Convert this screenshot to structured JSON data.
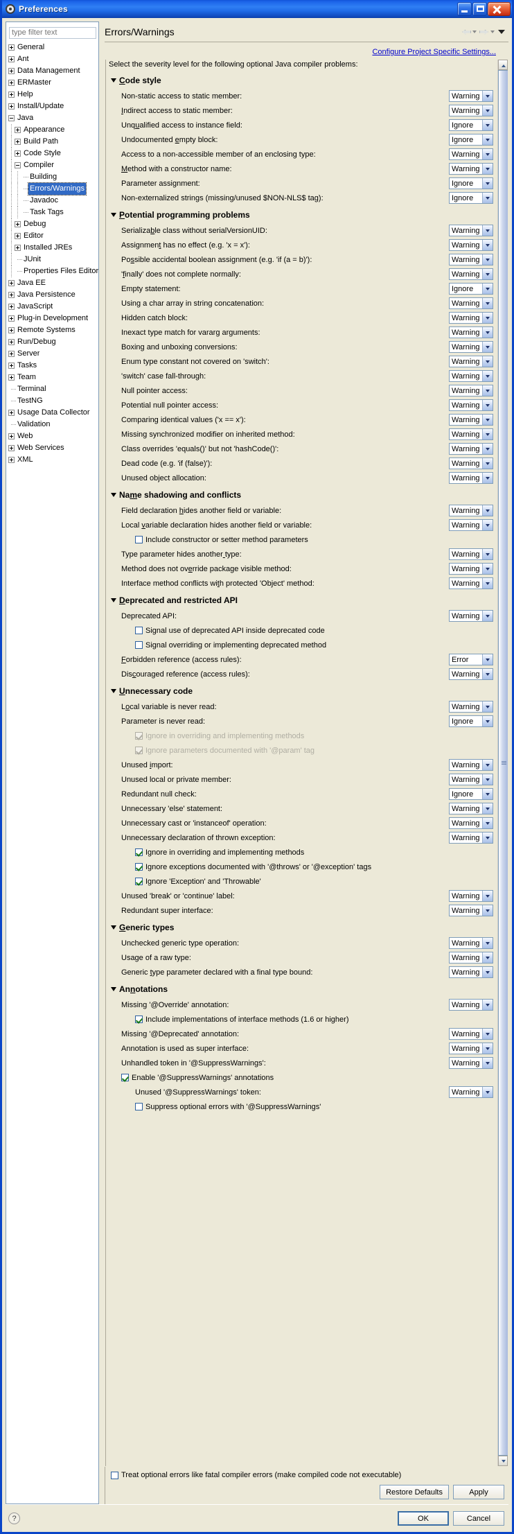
{
  "window": {
    "title": "Preferences",
    "icon": "gear-icon"
  },
  "titlebar_buttons": {
    "minimize": "minimize-icon",
    "maximize": "maximize-icon",
    "close": "close-icon"
  },
  "sidebar": {
    "filter_placeholder": "type filter text",
    "items": [
      {
        "label": "General",
        "depth": 0,
        "state": "collapsed"
      },
      {
        "label": "Ant",
        "depth": 0,
        "state": "collapsed"
      },
      {
        "label": "Data Management",
        "depth": 0,
        "state": "collapsed"
      },
      {
        "label": "ERMaster",
        "depth": 0,
        "state": "collapsed"
      },
      {
        "label": "Help",
        "depth": 0,
        "state": "collapsed"
      },
      {
        "label": "Install/Update",
        "depth": 0,
        "state": "collapsed"
      },
      {
        "label": "Java",
        "depth": 0,
        "state": "expanded"
      },
      {
        "label": "Appearance",
        "depth": 1,
        "state": "collapsed"
      },
      {
        "label": "Build Path",
        "depth": 1,
        "state": "collapsed"
      },
      {
        "label": "Code Style",
        "depth": 1,
        "state": "collapsed"
      },
      {
        "label": "Compiler",
        "depth": 1,
        "state": "expanded"
      },
      {
        "label": "Building",
        "depth": 2,
        "state": "leaf"
      },
      {
        "label": "Errors/Warnings",
        "depth": 2,
        "state": "leaf",
        "selected": true
      },
      {
        "label": "Javadoc",
        "depth": 2,
        "state": "leaf"
      },
      {
        "label": "Task Tags",
        "depth": 2,
        "state": "leaf"
      },
      {
        "label": "Debug",
        "depth": 1,
        "state": "collapsed"
      },
      {
        "label": "Editor",
        "depth": 1,
        "state": "collapsed"
      },
      {
        "label": "Installed JREs",
        "depth": 1,
        "state": "collapsed"
      },
      {
        "label": "JUnit",
        "depth": 1,
        "state": "leaf"
      },
      {
        "label": "Properties Files Editor",
        "depth": 1,
        "state": "leaf"
      },
      {
        "label": "Java EE",
        "depth": 0,
        "state": "collapsed"
      },
      {
        "label": "Java Persistence",
        "depth": 0,
        "state": "collapsed"
      },
      {
        "label": "JavaScript",
        "depth": 0,
        "state": "collapsed"
      },
      {
        "label": "Plug-in Development",
        "depth": 0,
        "state": "collapsed"
      },
      {
        "label": "Remote Systems",
        "depth": 0,
        "state": "collapsed"
      },
      {
        "label": "Run/Debug",
        "depth": 0,
        "state": "collapsed"
      },
      {
        "label": "Server",
        "depth": 0,
        "state": "collapsed"
      },
      {
        "label": "Tasks",
        "depth": 0,
        "state": "collapsed"
      },
      {
        "label": "Team",
        "depth": 0,
        "state": "collapsed"
      },
      {
        "label": "Terminal",
        "depth": 0,
        "state": "leaf"
      },
      {
        "label": "TestNG",
        "depth": 0,
        "state": "leaf"
      },
      {
        "label": "Usage Data Collector",
        "depth": 0,
        "state": "collapsed"
      },
      {
        "label": "Validation",
        "depth": 0,
        "state": "leaf"
      },
      {
        "label": "Web",
        "depth": 0,
        "state": "collapsed"
      },
      {
        "label": "Web Services",
        "depth": 0,
        "state": "collapsed"
      },
      {
        "label": "XML",
        "depth": 0,
        "state": "collapsed"
      }
    ]
  },
  "main": {
    "page_title": "Errors/Warnings",
    "configure_link": "Configure Project Specific Settings...",
    "intro": "Select the severity level for the following optional Java compiler problems:",
    "nav_back_icon": "arrow-left-icon",
    "nav_forward_icon": "arrow-right-icon",
    "menu_caret_icon": "chevron-down-icon",
    "sections": [
      {
        "title": "Code style",
        "mnemonic_index": 0,
        "rows": [
          {
            "kind": "combo",
            "label": "Non-static access to static member:",
            "value": "Warning",
            "mn": -1
          },
          {
            "kind": "combo",
            "label": "Indirect access to static member:",
            "value": "Warning",
            "mn": 0
          },
          {
            "kind": "combo",
            "label": "Unqualified access to instance field:",
            "value": "Ignore",
            "mn": 3
          },
          {
            "kind": "combo",
            "label": "Undocumented empty block:",
            "value": "Ignore",
            "mn": 13
          },
          {
            "kind": "combo",
            "label": "Access to a non-accessible member of an enclosing type:",
            "value": "Warning",
            "mn": -1
          },
          {
            "kind": "combo",
            "label": "Method with a constructor name:",
            "value": "Warning",
            "mn": 0
          },
          {
            "kind": "combo",
            "label": "Parameter assignment:",
            "value": "Ignore",
            "mn": -1
          },
          {
            "kind": "combo",
            "label": "Non-externalized strings (missing/unused $NON-NLS$ tag):",
            "value": "Ignore",
            "mn": -1
          }
        ]
      },
      {
        "title": "Potential programming problems",
        "mnemonic_index": 0,
        "rows": [
          {
            "kind": "combo",
            "label": "Serializable class without serialVersionUID:",
            "value": "Warning",
            "mn": 9
          },
          {
            "kind": "combo",
            "label": "Assignment has no effect (e.g. 'x = x'):",
            "value": "Warning",
            "mn": 9
          },
          {
            "kind": "combo",
            "label": "Possible accidental boolean assignment (e.g. 'if (a = b)'):",
            "value": "Warning",
            "mn": 2
          },
          {
            "kind": "combo",
            "label": "'finally' does not complete normally:",
            "value": "Warning",
            "mn": 1
          },
          {
            "kind": "combo",
            "label": "Empty statement:",
            "value": "Ignore",
            "mn": -1
          },
          {
            "kind": "combo",
            "label": "Using a char array in string concatenation:",
            "value": "Warning",
            "mn": -1
          },
          {
            "kind": "combo",
            "label": "Hidden catch block:",
            "value": "Warning",
            "mn": -1
          },
          {
            "kind": "combo",
            "label": "Inexact type match for vararg arguments:",
            "value": "Warning",
            "mn": -1
          },
          {
            "kind": "combo",
            "label": "Boxing and unboxing conversions:",
            "value": "Warning",
            "mn": -1
          },
          {
            "kind": "combo",
            "label": "Enum type constant not covered on 'switch':",
            "value": "Warning",
            "mn": -1
          },
          {
            "kind": "combo",
            "label": "'switch' case fall-through:",
            "value": "Warning",
            "mn": -1
          },
          {
            "kind": "combo",
            "label": "Null pointer access:",
            "value": "Warning",
            "mn": -1
          },
          {
            "kind": "combo",
            "label": "Potential null pointer access:",
            "value": "Warning",
            "mn": -1
          },
          {
            "kind": "combo",
            "label": "Comparing identical values ('x == x'):",
            "value": "Warning",
            "mn": -1
          },
          {
            "kind": "combo",
            "label": "Missing synchronized modifier on inherited method:",
            "value": "Warning",
            "mn": -1
          },
          {
            "kind": "combo",
            "label": "Class overrides 'equals()' but not 'hashCode()':",
            "value": "Warning",
            "mn": -1
          },
          {
            "kind": "combo",
            "label": "Dead code (e.g. 'if (false)'):",
            "value": "Warning",
            "mn": -1
          },
          {
            "kind": "combo",
            "label": "Unused object allocation:",
            "value": "Warning",
            "mn": -1
          }
        ]
      },
      {
        "title": "Name shadowing and conflicts",
        "mnemonic_index": 2,
        "rows": [
          {
            "kind": "combo",
            "label": "Field declaration hides another field or variable:",
            "value": "Warning",
            "mn": 18
          },
          {
            "kind": "combo",
            "label": "Local variable declaration hides another field or variable:",
            "value": "Warning",
            "mn": 6
          },
          {
            "kind": "check",
            "label": "Include constructor or setter method parameters",
            "checked": false,
            "indent": 1
          },
          {
            "kind": "combo",
            "label": "Type parameter hides another type:",
            "value": "Warning",
            "mn": 28
          },
          {
            "kind": "combo",
            "label": "Method does not override package visible method:",
            "value": "Warning",
            "mn": 18
          },
          {
            "kind": "combo",
            "label": "Interface method conflicts with protected 'Object' method:",
            "value": "Warning",
            "mn": 29
          }
        ]
      },
      {
        "title": "Deprecated and restricted API",
        "mnemonic_index": 0,
        "rows": [
          {
            "kind": "combo",
            "label": "Deprecated API:",
            "value": "Warning",
            "mn": -1
          },
          {
            "kind": "check",
            "label": "Signal use of deprecated API inside deprecated code",
            "checked": false,
            "indent": 1
          },
          {
            "kind": "check",
            "label": "Signal overriding or implementing deprecated method",
            "checked": false,
            "indent": 1
          },
          {
            "kind": "combo",
            "label": "Forbidden reference (access rules):",
            "value": "Error",
            "mn": 0
          },
          {
            "kind": "combo",
            "label": "Discouraged reference (access rules):",
            "value": "Warning",
            "mn": 3
          }
        ]
      },
      {
        "title": "Unnecessary code",
        "mnemonic_index": 0,
        "rows": [
          {
            "kind": "combo",
            "label": "Local variable is never read:",
            "value": "Warning",
            "mn": 1
          },
          {
            "kind": "combo",
            "label": "Parameter is never read:",
            "value": "Ignore",
            "mn": -1
          },
          {
            "kind": "check",
            "label": "Ignore in overriding and implementing methods",
            "checked": true,
            "disabled": true,
            "indent": 1
          },
          {
            "kind": "check",
            "label": "Ignore parameters documented with '@param' tag",
            "checked": true,
            "disabled": true,
            "indent": 1
          },
          {
            "kind": "combo",
            "label": "Unused import:",
            "value": "Warning",
            "mn": 7
          },
          {
            "kind": "combo",
            "label": "Unused local or private member:",
            "value": "Warning",
            "mn": -1
          },
          {
            "kind": "combo",
            "label": "Redundant null check:",
            "value": "Ignore",
            "mn": -1
          },
          {
            "kind": "combo",
            "label": "Unnecessary 'else' statement:",
            "value": "Warning",
            "mn": -1
          },
          {
            "kind": "combo",
            "label": "Unnecessary cast or 'instanceof' operation:",
            "value": "Warning",
            "mn": -1
          },
          {
            "kind": "combo",
            "label": "Unnecessary declaration of thrown exception:",
            "value": "Warning",
            "mn": -1
          },
          {
            "kind": "check",
            "label": "Ignore in overriding and implementing methods",
            "checked": true,
            "indent": 1
          },
          {
            "kind": "check",
            "label": "Ignore exceptions documented with '@throws' or '@exception' tags",
            "checked": true,
            "indent": 1
          },
          {
            "kind": "check",
            "label": "Ignore 'Exception' and 'Throwable'",
            "checked": true,
            "indent": 1
          },
          {
            "kind": "combo",
            "label": "Unused 'break' or 'continue' label:",
            "value": "Warning",
            "mn": -1
          },
          {
            "kind": "combo",
            "label": "Redundant super interface:",
            "value": "Warning",
            "mn": -1
          }
        ]
      },
      {
        "title": "Generic types",
        "mnemonic_index": 0,
        "rows": [
          {
            "kind": "combo",
            "label": "Unchecked generic type operation:",
            "value": "Warning",
            "mn": -1
          },
          {
            "kind": "combo",
            "label": "Usage of a raw type:",
            "value": "Warning",
            "mn": -1
          },
          {
            "kind": "combo",
            "label": "Generic type parameter declared with a final type bound:",
            "value": "Warning",
            "mn": 8
          }
        ]
      },
      {
        "title": "Annotations",
        "mnemonic_index": 2,
        "rows": [
          {
            "kind": "combo",
            "label": "Missing '@Override' annotation:",
            "value": "Warning",
            "mn": -1
          },
          {
            "kind": "check",
            "label": "Include implementations of interface methods (1.6 or higher)",
            "checked": true,
            "indent": 1
          },
          {
            "kind": "combo",
            "label": "Missing '@Deprecated' annotation:",
            "value": "Warning",
            "mn": -1
          },
          {
            "kind": "combo",
            "label": "Annotation is used as super interface:",
            "value": "Warning",
            "mn": -1
          },
          {
            "kind": "combo",
            "label": "Unhandled token in '@SuppressWarnings':",
            "value": "Warning",
            "mn": -1
          },
          {
            "kind": "check",
            "label": "Enable '@SuppressWarnings' annotations",
            "checked": true,
            "indent": 0
          },
          {
            "kind": "combo",
            "label": "Unused '@SuppressWarnings' token:",
            "value": "Warning",
            "mn": -1,
            "indent": 1
          },
          {
            "kind": "check",
            "label": "Suppress optional errors with '@SuppressWarnings'",
            "checked": false,
            "indent": 1
          }
        ]
      }
    ],
    "fatal_errors_option": {
      "label": "Treat optional errors like fatal compiler errors (make compiled code not executable)",
      "checked": false
    },
    "restore_defaults_label": "Restore Defaults",
    "apply_label": "Apply"
  },
  "footer": {
    "help_icon": "question-mark-icon",
    "ok_label": "OK",
    "cancel_label": "Cancel"
  },
  "colors": {
    "titlebar_blue": "#1f6ae6",
    "dialog_bg": "#ece9d8",
    "selection_blue": "#316ac5",
    "link_blue": "#0000cc",
    "border_blue": "#0a46c8"
  }
}
